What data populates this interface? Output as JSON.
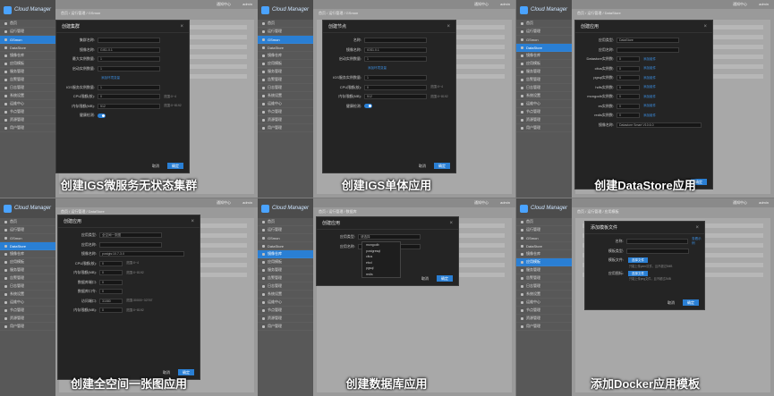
{
  "app": {
    "logo_text": "Cloud Manager",
    "user": "admin",
    "bell": "通知中心",
    "nav": [
      "首页",
      "运行管理",
      "GSmon",
      "DataStore",
      "镜像仓库",
      "应用模板",
      "服务管理",
      "告警管理",
      "日志管理",
      "系统设置",
      "运维中心",
      "节点管理",
      "资源管理",
      "用户管理"
    ]
  },
  "panels": [
    {
      "caption": "创建IGS微服务无状态集群",
      "modal_title": "创建集群",
      "crumb": "首页 / 运行管理 / GSmon",
      "fields": [
        {
          "label": "集群名称:",
          "value": ""
        },
        {
          "label": "镜像名称:",
          "value": "GIS1.0.1"
        },
        {
          "label": "最大实例数量:",
          "value": "1"
        },
        {
          "label": "启动实例数量:",
          "value": "1"
        },
        {
          "label": "",
          "link": "添加环境变量"
        },
        {
          "label": "IGS服务实例数量:",
          "value": "1"
        },
        {
          "label": "CPU限额(核):",
          "value": "0",
          "hint": "范围:0~4"
        },
        {
          "label": "内存限额(MB):",
          "value": "512",
          "hint": "范围:0~8192"
        },
        {
          "label": "健康检测:",
          "toggle": true
        }
      ],
      "cancel": "取消",
      "ok": "确定"
    },
    {
      "caption": "创建IGS单体应用",
      "modal_title": "创建节点",
      "crumb": "首页 / 运行管理 / GSmon",
      "fields": [
        {
          "label": "名称:",
          "value": ""
        },
        {
          "label": "镜像名称:",
          "value": "IGS1.0.1"
        },
        {
          "label": "启动实例数量:",
          "value": "1"
        },
        {
          "label": "",
          "link": "添加环境变量"
        },
        {
          "label": "IGS服务实例数量:",
          "value": "1"
        },
        {
          "label": "CPU限额(核):",
          "value": "0",
          "hint": "范围:0~4"
        },
        {
          "label": "内存限额(MB):",
          "value": "512",
          "hint": "范围:0~8192"
        },
        {
          "label": "健康检测:",
          "toggle": true
        }
      ],
      "cancel": "取消",
      "ok": "确定"
    },
    {
      "caption": "创建DataStore应用",
      "modal_title": "创建应用",
      "crumb": "首页 / 运行管理 / DataStore",
      "fields": [
        {
          "label": "应用类型:",
          "value": "DataStore"
        },
        {
          "label": "应用名称:",
          "value": ""
        },
        {
          "label": "Datastore实例数:",
          "value": "0",
          "link": "添加组件"
        },
        {
          "label": "citus实例数:",
          "value": "0",
          "link": "添加组件"
        },
        {
          "label": "pgsql实例数:",
          "value": "0",
          "link": "添加组件"
        },
        {
          "label": "hdfs实例数:",
          "value": "0",
          "link": "添加组件"
        },
        {
          "label": "mongodb实例数:",
          "value": "0",
          "link": "添加组件"
        },
        {
          "label": "es实例数:",
          "value": "0",
          "link": "添加组件"
        },
        {
          "label": "redis实例数:",
          "value": "0",
          "link": "添加组件"
        },
        {
          "label": "镜像名称:",
          "value": "Datastore Smart V10.6.0"
        }
      ],
      "cancel": "取消",
      "ok": "确定"
    },
    {
      "caption": "创建全空间一张图应用",
      "modal_title": "创建应用",
      "crumb": "首页 / 运行管理 / DataStore",
      "fields": [
        {
          "label": "应用类型:",
          "value": "全空间一张图"
        },
        {
          "label": "应用名称:",
          "value": ""
        },
        {
          "label": "镜像名称:",
          "value": "postgis:10.7-3.0"
        },
        {
          "label": "CPU限额(核):",
          "value": "0",
          "hint": "范围:0~4"
        },
        {
          "label": "内存限额(MB):",
          "value": "0",
          "hint": "范围:0~8192"
        },
        {
          "label": "数据库端口:",
          "value": "0"
        },
        {
          "label": "数据库口令:",
          "value": "0"
        },
        {
          "label": "访问端口:",
          "value": "31080",
          "hint": "范围:30000~32767"
        },
        {
          "label": "内存限额(MB):",
          "value": "0",
          "hint": "范围:0~8192"
        }
      ],
      "cancel": "取消",
      "ok": "确定"
    },
    {
      "caption": "创建数据库应用",
      "modal_title": "创建应用",
      "crumb": "首页 / 运行管理 / 数据库",
      "fields": [
        {
          "label": "应用类型:",
          "value": "请选择"
        },
        {
          "label": "应用名称:",
          "value": ""
        }
      ],
      "dropdown": [
        "mongodb",
        "postgresql",
        "citus",
        "etcd",
        "pgsql",
        "redis"
      ],
      "cancel": "取消",
      "ok": "确定"
    },
    {
      "caption": "添加Docker应用模板",
      "modal_title": "添加模板文件",
      "crumb": "首页 / 运行管理 / 应用模板",
      "fields": [
        {
          "label": "名称:",
          "value": "",
          "link": "查看示例"
        },
        {
          "label": "模板类型:",
          "value": ""
        },
        {
          "label": "模板文件:",
          "upload": "选择文件",
          "note": "只能上传yaml文件，且不超过5MB"
        },
        {
          "label": "应用图标:",
          "upload": "选择文件",
          "note": "只能上传png文件，且不超过2MB"
        }
      ],
      "cancel": "取消",
      "ok": "确定"
    }
  ]
}
